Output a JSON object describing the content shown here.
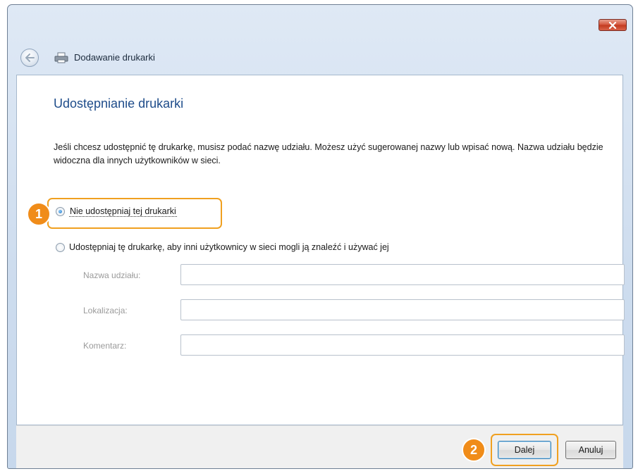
{
  "window": {
    "title": "Dodawanie drukarki",
    "close_icon": "close-icon",
    "back_icon": "back-arrow-icon",
    "printer_icon": "printer-icon"
  },
  "main": {
    "heading": "Udostępnianie drukarki",
    "description": "Jeśli chcesz udostępnić tę drukarkę, musisz podać nazwę udziału. Możesz użyć sugerowanej nazwy lub wpisać nową. Nazwa udziału będzie widoczna dla innych użytkowników w sieci.",
    "options": [
      {
        "label": "Nie udostępniaj tej drukarki",
        "checked": true
      },
      {
        "label": "Udostępniaj tę drukarkę, aby inni użytkownicy w sieci mogli ją znaleźć i używać jej",
        "checked": false
      }
    ],
    "fields": [
      {
        "label": "Nazwa udziału:",
        "value": ""
      },
      {
        "label": "Lokalizacja:",
        "value": ""
      },
      {
        "label": "Komentarz:",
        "value": ""
      }
    ]
  },
  "footer": {
    "next_label": "Dalej",
    "cancel_label": "Anuluj"
  },
  "callouts": {
    "step1": "1",
    "step2": "2",
    "color": "#f08c19"
  }
}
